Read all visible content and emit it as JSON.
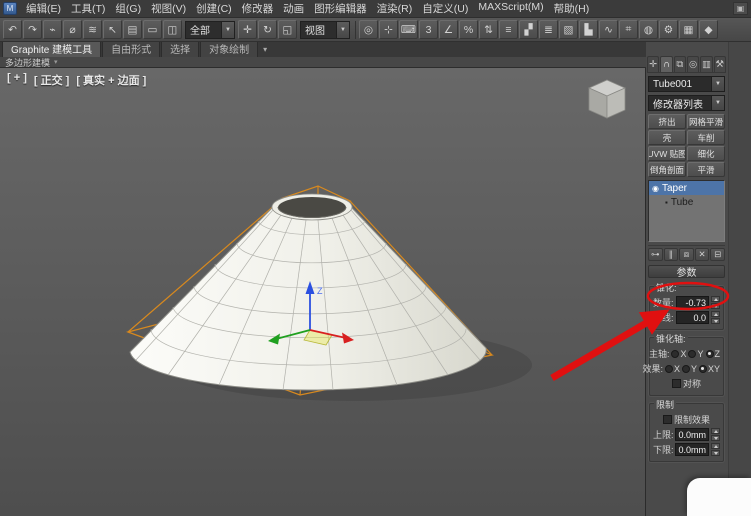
{
  "menubar": {
    "items": [
      "编辑(E)",
      "工具(T)",
      "组(G)",
      "视图(V)",
      "创建(C)",
      "修改器",
      "动画",
      "图形编辑器",
      "渲染(R)",
      "自定义(U)",
      "MAXScript(M)",
      "帮助(H)"
    ]
  },
  "toolbar": {
    "icons_a": [
      {
        "name": "undo-icon",
        "glyph": "↶"
      },
      {
        "name": "redo-icon",
        "glyph": "↷"
      },
      {
        "name": "select-and-link-icon",
        "glyph": "⌁"
      },
      {
        "name": "unlink-selection-icon",
        "glyph": "⌀"
      },
      {
        "name": "bind-to-spacewarp-icon",
        "glyph": "≋"
      },
      {
        "name": "select-object-icon",
        "glyph": "↖"
      },
      {
        "name": "select-by-name-icon",
        "glyph": "▤"
      },
      {
        "name": "rectangular-selection-region-icon",
        "glyph": "▭"
      },
      {
        "name": "window-crossing-icon",
        "glyph": "◫"
      }
    ],
    "selection_filter": "全部",
    "icons_b": [
      {
        "name": "select-and-move-icon",
        "glyph": "✛"
      },
      {
        "name": "select-and-rotate-icon",
        "glyph": "↻"
      },
      {
        "name": "select-and-scale-icon",
        "glyph": "◱"
      }
    ],
    "coord_system": "视图",
    "icons_c": [
      {
        "name": "use-pivot-center-icon",
        "glyph": "◎"
      },
      {
        "name": "select-and-manipulate-icon",
        "glyph": "⊹"
      },
      {
        "name": "keyboard-shortcut-override-icon",
        "glyph": "⌨"
      },
      {
        "name": "snap-toggle-icon",
        "glyph": "3"
      },
      {
        "name": "angle-snap-icon",
        "glyph": "∠"
      },
      {
        "name": "percent-snap-icon",
        "glyph": "%"
      },
      {
        "name": "spinner-snap-icon",
        "glyph": "⇅"
      },
      {
        "name": "named-selection-sets-icon",
        "glyph": "≡"
      },
      {
        "name": "mirror-icon",
        "glyph": "▞"
      },
      {
        "name": "align-icon",
        "glyph": "≣"
      },
      {
        "name": "layer-manager-icon",
        "glyph": "▧"
      },
      {
        "name": "graphite-toggle-icon",
        "glyph": "▙"
      },
      {
        "name": "curve-editor-icon",
        "glyph": "∿"
      },
      {
        "name": "schematic-view-icon",
        "glyph": "⌗"
      },
      {
        "name": "material-editor-icon",
        "glyph": "◍"
      },
      {
        "name": "render-setup-icon",
        "glyph": "⚙"
      },
      {
        "name": "rendered-frame-icon",
        "glyph": "▦"
      },
      {
        "name": "render-production-icon",
        "glyph": "◆"
      }
    ]
  },
  "ribbon": {
    "tabs": [
      {
        "label": "Graphite 建模工具"
      },
      {
        "label": "自由形式"
      },
      {
        "label": "选择"
      },
      {
        "label": "对象绘制"
      }
    ],
    "panel_label": "多边形建模"
  },
  "viewport": {
    "general_label": "[ + ]",
    "pov_label": "[ 正交 ]",
    "shading_label": "[ 真实 + 边面 ]",
    "gizmo_z_label": "Z"
  },
  "command_panel": {
    "tabs": [
      {
        "glyph": "✛"
      },
      {
        "glyph": "∩"
      },
      {
        "glyph": "⧉"
      },
      {
        "glyph": "◎"
      },
      {
        "glyph": "▥"
      },
      {
        "glyph": "⚒"
      }
    ],
    "object_name": "Tube001",
    "modifier_list_label": "修改器列表",
    "modifier_buttons": [
      "挤出",
      "网格平滑",
      "壳",
      "车削",
      "UVW 贴图",
      "细化",
      "倒角剖面",
      "平滑"
    ],
    "stack": [
      {
        "label": "Taper"
      },
      {
        "label": "Tube"
      }
    ],
    "stack_tools": [
      {
        "name": "pin-stack-icon",
        "glyph": "⊶"
      },
      {
        "name": "show-end-result-icon",
        "glyph": "∥"
      },
      {
        "name": "make-unique-icon",
        "glyph": "⧈"
      },
      {
        "name": "remove-modifier-icon",
        "glyph": "✕"
      },
      {
        "name": "configure-modifier-sets-icon",
        "glyph": "⊟"
      }
    ],
    "parameters": {
      "title": "参数",
      "taper_group_label": "锥化:",
      "amount_label": "数量:",
      "amount_value": "-0.73",
      "curve_label": "曲线:",
      "curve_value": "0.0",
      "axis_group_label": "锥化轴:",
      "primary_label": "主轴:",
      "primary_options": [
        "X",
        "Y",
        "Z"
      ],
      "effect_label": "效果:",
      "effect_options": [
        "X",
        "Y",
        "XY"
      ],
      "symmetry_label": "对称",
      "limits_group_label": "限制",
      "limit_effect_label": "限制效果",
      "upper_limit_label": "上限:",
      "upper_limit_value": "0.0mm",
      "lower_limit_label": "下限:",
      "lower_limit_value": "0.0mm"
    }
  },
  "icons": {
    "app_glyph": "M",
    "dropdown_arrow": "▼",
    "chevron_down": "▾",
    "stack_bulb": "◉",
    "stack_item": "▪",
    "workspace": "▣"
  },
  "colors": {
    "annotation_red": "#e01010",
    "selection_blue": "#4d74a8",
    "gizmo_orange": "#d8891e"
  }
}
